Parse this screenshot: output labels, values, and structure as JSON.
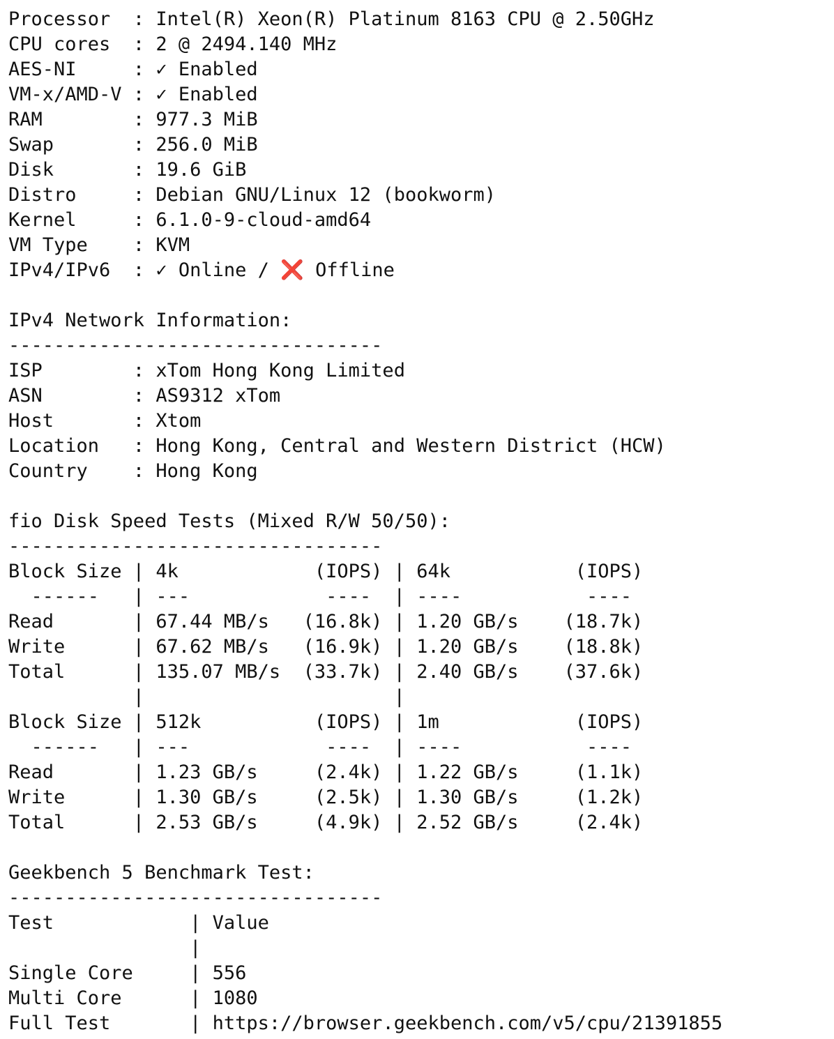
{
  "colors": {
    "text": "#111111",
    "background": "#ffffff",
    "fail_mark": "#e8365a"
  },
  "system_info": {
    "rows": [
      {
        "label": "Processor  ",
        "value": "Intel(R) Xeon(R) Platinum 8163 CPU @ 2.50GHz"
      },
      {
        "label": "CPU cores  ",
        "value": "2 @ 2494.140 MHz"
      },
      {
        "label": "AES-NI     ",
        "check": "✓",
        "value": "Enabled"
      },
      {
        "label": "VM-x/AMD-V ",
        "check": "✓",
        "value": "Enabled"
      },
      {
        "label": "RAM        ",
        "value": "977.3 MiB"
      },
      {
        "label": "Swap       ",
        "value": "256.0 MiB"
      },
      {
        "label": "Disk       ",
        "value": "19.6 GiB"
      },
      {
        "label": "Distro     ",
        "value": "Debian GNU/Linux 12 (bookworm)"
      },
      {
        "label": "Kernel     ",
        "value": "6.1.0-9-cloud-amd64"
      },
      {
        "label": "VM Type    ",
        "value": "KVM"
      }
    ],
    "ip_row": {
      "label": "IPv4/IPv6  ",
      "ok_icon": "✓",
      "ok_text": "Online",
      "separator": "/",
      "fail_icon": "❌",
      "fail_text": "Offline"
    }
  },
  "network": {
    "title": "IPv4 Network Information:",
    "divider": "---------------------------------",
    "rows": [
      {
        "label": "ISP        ",
        "value": "xTom Hong Kong Limited"
      },
      {
        "label": "ASN        ",
        "value": "AS9312 xTom"
      },
      {
        "label": "Host       ",
        "value": "Xtom"
      },
      {
        "label": "Location   ",
        "value": "Hong Kong, Central and Western District (HCW)"
      },
      {
        "label": "Country    ",
        "value": "Hong Kong"
      }
    ]
  },
  "fio": {
    "title": "fio Disk Speed Tests (Mixed R/W 50/50):",
    "divider": "---------------------------------",
    "lines": [
      "Block Size | 4k            (IOPS) | 64k           (IOPS)",
      "  ------   | ---            ----  | ----           ----",
      "Read       | 67.44 MB/s   (16.8k) | 1.20 GB/s    (18.7k)",
      "Write      | 67.62 MB/s   (16.9k) | 1.20 GB/s    (18.8k)",
      "Total      | 135.07 MB/s  (33.7k) | 2.40 GB/s    (37.6k)",
      "           |                      |",
      "Block Size | 512k          (IOPS) | 1m            (IOPS)",
      "  ------   | ---            ----  | ----           ----",
      "Read       | 1.23 GB/s     (2.4k) | 1.22 GB/s     (1.1k)",
      "Write      | 1.30 GB/s     (2.5k) | 1.30 GB/s     (1.2k)",
      "Total      | 2.53 GB/s     (4.9k) | 2.52 GB/s     (2.4k)"
    ]
  },
  "geekbench": {
    "title": "Geekbench 5 Benchmark Test:",
    "divider": "---------------------------------",
    "header": "Test            | Value",
    "spacer": "                |",
    "rows": [
      {
        "label": "Single Core     ",
        "value": "556"
      },
      {
        "label": "Multi Core      ",
        "value": "1080"
      },
      {
        "label": "Full Test       ",
        "value": "https://browser.geekbench.com/v5/cpu/21391855"
      }
    ]
  }
}
